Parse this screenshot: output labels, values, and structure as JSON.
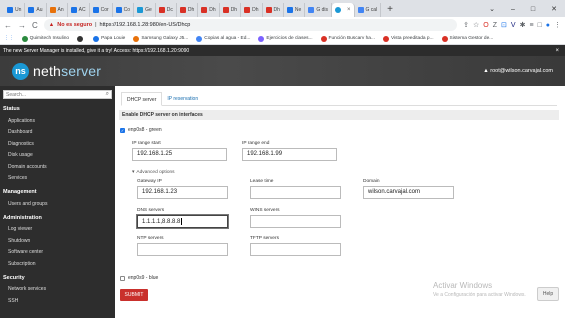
{
  "browser": {
    "tabs": [
      {
        "label": "Un",
        "color": "#1a73e8"
      },
      {
        "label": "Au",
        "color": "#1a73e8"
      },
      {
        "label": "An",
        "color": "#e8710a"
      },
      {
        "label": "AC",
        "color": "#1a73e8"
      },
      {
        "label": "Cor",
        "color": "#1a73e8"
      },
      {
        "label": "Co",
        "color": "#1a73e8"
      },
      {
        "label": "Ge",
        "color": "#1a98d5"
      },
      {
        "label": "Dc",
        "color": "#d93025"
      },
      {
        "label": "Dh",
        "color": "#d93025"
      },
      {
        "label": "Dh",
        "color": "#d93025"
      },
      {
        "label": "Dh",
        "color": "#d93025"
      },
      {
        "label": "Dh",
        "color": "#d93025"
      },
      {
        "label": "Dh",
        "color": "#d93025"
      },
      {
        "label": "Ne",
        "color": "#1a73e8"
      },
      {
        "label": "G dis",
        "color": "#4285f4"
      },
      {
        "label": "",
        "color": "#1a98d5",
        "active": true
      },
      {
        "label": "G cal",
        "color": "#4285f4"
      }
    ],
    "new_tab": "+",
    "window_controls": {
      "minimize": "⌄",
      "min": "–",
      "max": "□",
      "close": "✕"
    },
    "nav": {
      "back": "←",
      "forward": "→",
      "reload": "C"
    },
    "url": {
      "warning": "No es seguro",
      "separator": "|",
      "address": "https://192.168.1.28:980/en-US/Dhcp"
    },
    "extensions": [
      "⇪",
      "☆",
      "O",
      "Z",
      "⊡",
      "V",
      "✱",
      "≡",
      "□",
      "●",
      "⋮"
    ],
    "bookmarks": [
      {
        "label": "Quimitech Insulino",
        "color": "#2b8a3e"
      },
      {
        "label": "",
        "color": "#333333"
      },
      {
        "label": "Papa Louie",
        "color": "#1a73e8"
      },
      {
        "label": "Samsung Galaxy J5...",
        "color": "#e8710a"
      },
      {
        "label": "Copias al agua - Ed...",
        "color": "#4285f4"
      },
      {
        "label": "Ejercicios de clases...",
        "color": "#7b61ff"
      },
      {
        "label": "Función Buscarv ha...",
        "color": "#d93025"
      },
      {
        "label": "Vista preeditada p...",
        "color": "#d93025"
      },
      {
        "label": "Sistema Gestor de...",
        "color": "#d93025"
      }
    ]
  },
  "notice": {
    "text": "The new Server Manager is installed, give it a try! Access: https://192.168.1.20:9090",
    "close": "×"
  },
  "header": {
    "logo_mark": "ns",
    "logo_primary": "neth",
    "logo_secondary": "server",
    "user": "▲ root@wilson.carvajal.com"
  },
  "sidebar": {
    "search_placeholder": "Search...",
    "search_icon": "⌕",
    "sections": [
      {
        "title": "Status",
        "items": [
          "Applications",
          "Dashboard",
          "Diagnostics",
          "Disk usage",
          "Domain accounts",
          "Services"
        ]
      },
      {
        "title": "Management",
        "items": [
          "Users and groups"
        ]
      },
      {
        "title": "Administration",
        "items": [
          "Log viewer",
          "Shutdown",
          "Software center",
          "Subscription"
        ]
      },
      {
        "title": "Security",
        "items": [
          "Network services",
          "SSH"
        ]
      }
    ]
  },
  "main": {
    "tabs": [
      "DHCP server",
      "IP reservation"
    ],
    "interfaces_title": "Enable DHCP server on interfaces",
    "iface_green": "enp0s8 - green",
    "iface_green_checked": true,
    "iface_blue": "enp0s9 - blue",
    "iface_blue_checked": false,
    "check_mark": "✓",
    "range_start_label": "IP range start",
    "range_start_value": "192.168.1.25",
    "range_end_label": "IP range end",
    "range_end_value": "192.168.1.99",
    "advanced_label": "Advanced options",
    "advanced_marker": "▾",
    "gateway_label": "Gateway IP",
    "gateway_value": "192.168.1.23",
    "lease_label": "Lease time",
    "lease_value": "",
    "domain_label": "Domain",
    "domain_value": "wilson.carvajal.com",
    "dns_label": "DNS servers",
    "dns_value": "1.1.1.1,8.8.8.8",
    "wins_label": "WINS servers",
    "wins_value": "",
    "ntp_label": "NTP servers",
    "ntp_value": "",
    "tftp_label": "TFTP servers",
    "tftp_value": "",
    "submit": "SUBMIT"
  },
  "watermark": {
    "line1": "Activar Windows",
    "line2": "Ve a Configuración para activar Windows."
  },
  "help": "Help"
}
